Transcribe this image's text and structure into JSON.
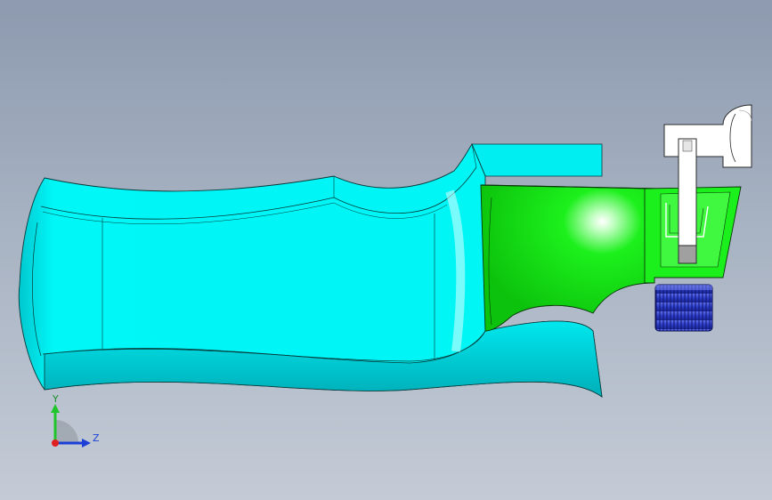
{
  "viewport": {
    "background_top": "#8d9aaf",
    "background_bottom": "#c4cbd6"
  },
  "model": {
    "grip_color": "#00f5f5",
    "grip_shadow_color": "#00b8c4",
    "sleeve_color": "#16ec16",
    "sleeve_dark_color": "#00a800",
    "knob_color": "#2d3ec8",
    "bracket_color": "#ffffff"
  },
  "triad": {
    "axes": {
      "y_label": "Y",
      "z_label": "Z"
    },
    "colors": {
      "y_axis": "#1fc62b",
      "z_axis": "#1c3fd6",
      "origin": "#e02020"
    }
  }
}
